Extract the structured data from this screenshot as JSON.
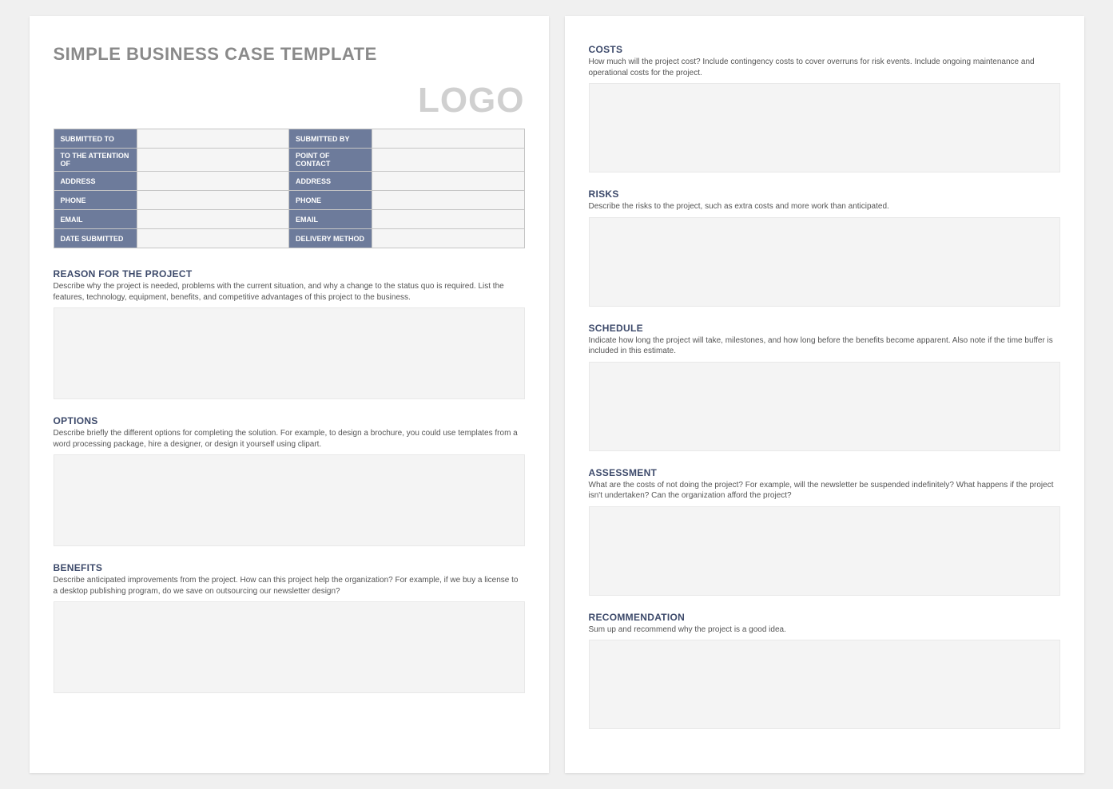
{
  "title": "SIMPLE BUSINESS CASE TEMPLATE",
  "logo": "LOGO",
  "info_rows": [
    {
      "left_label": "SUBMITTED TO",
      "left_value": "",
      "right_label": "SUBMITTED BY",
      "right_value": ""
    },
    {
      "left_label": "TO THE ATTENTION OF",
      "left_value": "",
      "right_label": "POINT OF CONTACT",
      "right_value": ""
    },
    {
      "left_label": "ADDRESS",
      "left_value": "",
      "right_label": "ADDRESS",
      "right_value": ""
    },
    {
      "left_label": "PHONE",
      "left_value": "",
      "right_label": "PHONE",
      "right_value": ""
    },
    {
      "left_label": "EMAIL",
      "left_value": "",
      "right_label": "EMAIL",
      "right_value": ""
    },
    {
      "left_label": "DATE SUBMITTED",
      "left_value": "",
      "right_label": "DELIVERY METHOD",
      "right_value": ""
    }
  ],
  "sections_left": [
    {
      "head": "REASON FOR THE PROJECT",
      "desc": "Describe why the project is needed, problems with the current situation, and why a change to the status quo is required. List the features, technology, equipment, benefits, and competitive advantages of this project to the business."
    },
    {
      "head": "OPTIONS",
      "desc": "Describe briefly the different options for completing the solution. For example, to design a brochure, you could use templates from a word processing package, hire a designer, or design it yourself using clipart."
    },
    {
      "head": "BENEFITS",
      "desc": "Describe anticipated improvements from the project. How can this project help the organization? For example, if we buy a license to a desktop publishing program, do we save on outsourcing our newsletter design?"
    }
  ],
  "sections_right": [
    {
      "head": "COSTS",
      "desc": "How much will the project cost? Include contingency costs to cover overruns for risk events. Include ongoing maintenance and operational costs for the project."
    },
    {
      "head": "RISKS",
      "desc": "Describe the risks to the project, such as extra costs and more work than anticipated."
    },
    {
      "head": "SCHEDULE",
      "desc": "Indicate how long the project will take, milestones, and how long before the benefits become apparent. Also note if the time buffer is included in this estimate."
    },
    {
      "head": "ASSESSMENT",
      "desc": "What are the costs of not doing the project? For example, will the newsletter be suspended indefinitely? What happens if the project isn't undertaken? Can the organization afford the project?"
    },
    {
      "head": "RECOMMENDATION",
      "desc": "Sum up and recommend why the project is a good idea."
    }
  ]
}
